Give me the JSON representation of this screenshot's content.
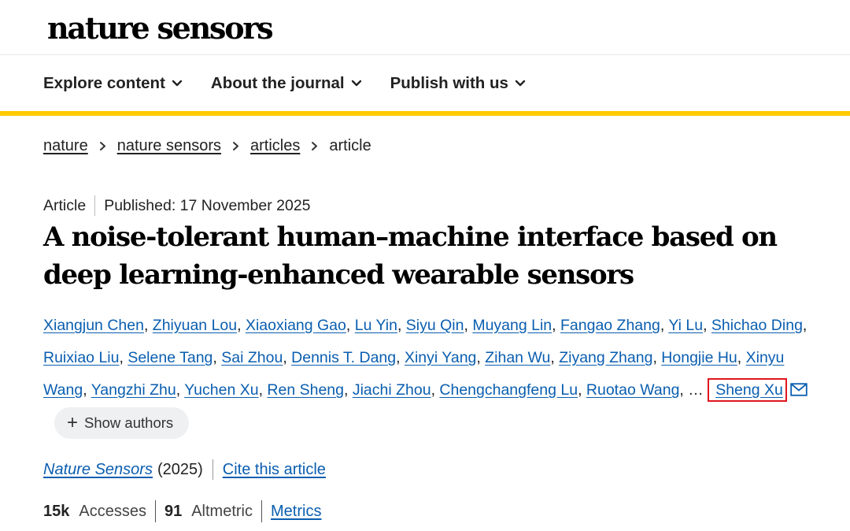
{
  "header": {
    "logo": "nature sensors"
  },
  "nav": {
    "items": [
      {
        "label": "Explore content"
      },
      {
        "label": "About the journal"
      },
      {
        "label": "Publish with us"
      }
    ]
  },
  "breadcrumb": {
    "items": [
      "nature",
      "nature sensors",
      "articles"
    ],
    "current": "article"
  },
  "article": {
    "type": "Article",
    "published": "Published: 17 November 2025",
    "title": "A noise-tolerant human–machine interface based on deep learning-enhanced wearable sensors"
  },
  "authors": {
    "list": [
      "Xiangjun Chen",
      "Zhiyuan Lou",
      "Xiaoxiang Gao",
      "Lu Yin",
      "Siyu Qin",
      "Muyang Lin",
      "Fangao Zhang",
      "Yi Lu",
      "Shichao Ding",
      "Ruixiao Liu",
      "Selene Tang",
      "Sai Zhou",
      "Dennis T. Dang",
      "Xinyi Yang",
      "Zihan Wu",
      "Ziyang Zhang",
      "Hongjie Hu",
      "Xinyu Wang",
      "Yangzhi Zhu",
      "Yuchen Xu",
      "Ren Sheng",
      "Jiachi Zhou",
      "Chengchangfeng Lu",
      "Ruotao Wang"
    ],
    "ellipsis": ", …",
    "corresponding": "Sheng Xu",
    "show_authors_label": "Show authors"
  },
  "citation": {
    "journal": "Nature Sensors",
    "year": "(2025)",
    "cite_label": "Cite this article"
  },
  "metrics": {
    "accesses_value": "15k",
    "accesses_label": "Accesses",
    "altmetric_value": "91",
    "altmetric_label": "Altmetric",
    "metrics_link": "Metrics"
  },
  "colors": {
    "accent_bar": "#ffcc00",
    "link": "#0a5eb0",
    "highlight": "#e0161e"
  }
}
